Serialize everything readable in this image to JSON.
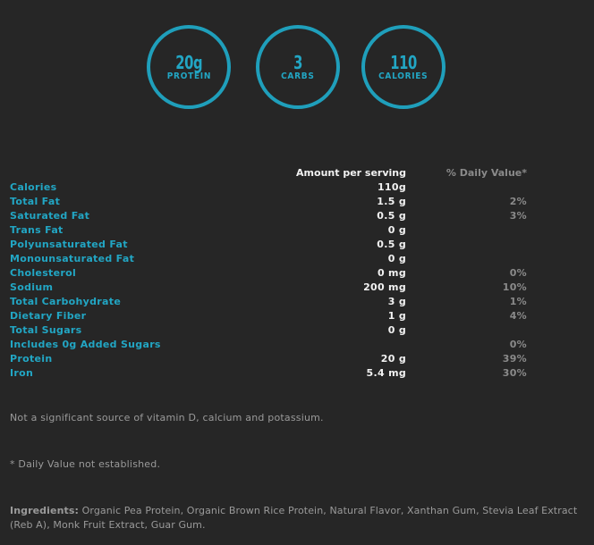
{
  "highlights": [
    {
      "value": "20g",
      "label": "PROTEIN"
    },
    {
      "value": "3",
      "label": "CARBS"
    },
    {
      "value": "110",
      "label": "CALORIES"
    }
  ],
  "colors": {
    "background": "#262626",
    "accent": "#22a6c4",
    "amount_text": "#f2f2f2",
    "muted_text": "#8a8a8a"
  },
  "table": {
    "header_amount": "Amount per serving",
    "header_dv": "% Daily Value*",
    "rows": [
      {
        "name": "Calories",
        "amount": "110g",
        "dv": ""
      },
      {
        "name": "Total Fat",
        "amount": "1.5 g",
        "dv": "2%"
      },
      {
        "name": "Saturated Fat",
        "amount": "0.5 g",
        "dv": "3%"
      },
      {
        "name": "Trans Fat",
        "amount": "0 g",
        "dv": ""
      },
      {
        "name": "Polyunsaturated Fat",
        "amount": "0.5 g",
        "dv": ""
      },
      {
        "name": "Monounsaturated Fat",
        "amount": "0 g",
        "dv": ""
      },
      {
        "name": "Cholesterol",
        "amount": "0 mg",
        "dv": "0%"
      },
      {
        "name": "Sodium",
        "amount": "200 mg",
        "dv": "10%"
      },
      {
        "name": "Total Carbohydrate",
        "amount": "3 g",
        "dv": "1%"
      },
      {
        "name": "Dietary Fiber",
        "amount": "1 g",
        "dv": "4%"
      },
      {
        "name": "Total Sugars",
        "amount": "0 g",
        "dv": ""
      },
      {
        "name": "Includes 0g Added Sugars",
        "amount": "",
        "dv": "0%"
      },
      {
        "name": "Protein",
        "amount": "20 g",
        "dv": "39%"
      },
      {
        "name": "Iron",
        "amount": "5.4 mg",
        "dv": "30%"
      }
    ]
  },
  "notes": {
    "vitamins": "Not a significant source of vitamin D, calcium and potassium.",
    "daily_value": "* Daily Value not established."
  },
  "ingredients": {
    "label": "Ingredients:",
    "text": " Organic Pea Protein, Organic Brown Rice Protein, Natural Flavor, Xanthan Gum, Stevia Leaf Extract (Reb A), Monk Fruit Extract, Guar Gum."
  }
}
